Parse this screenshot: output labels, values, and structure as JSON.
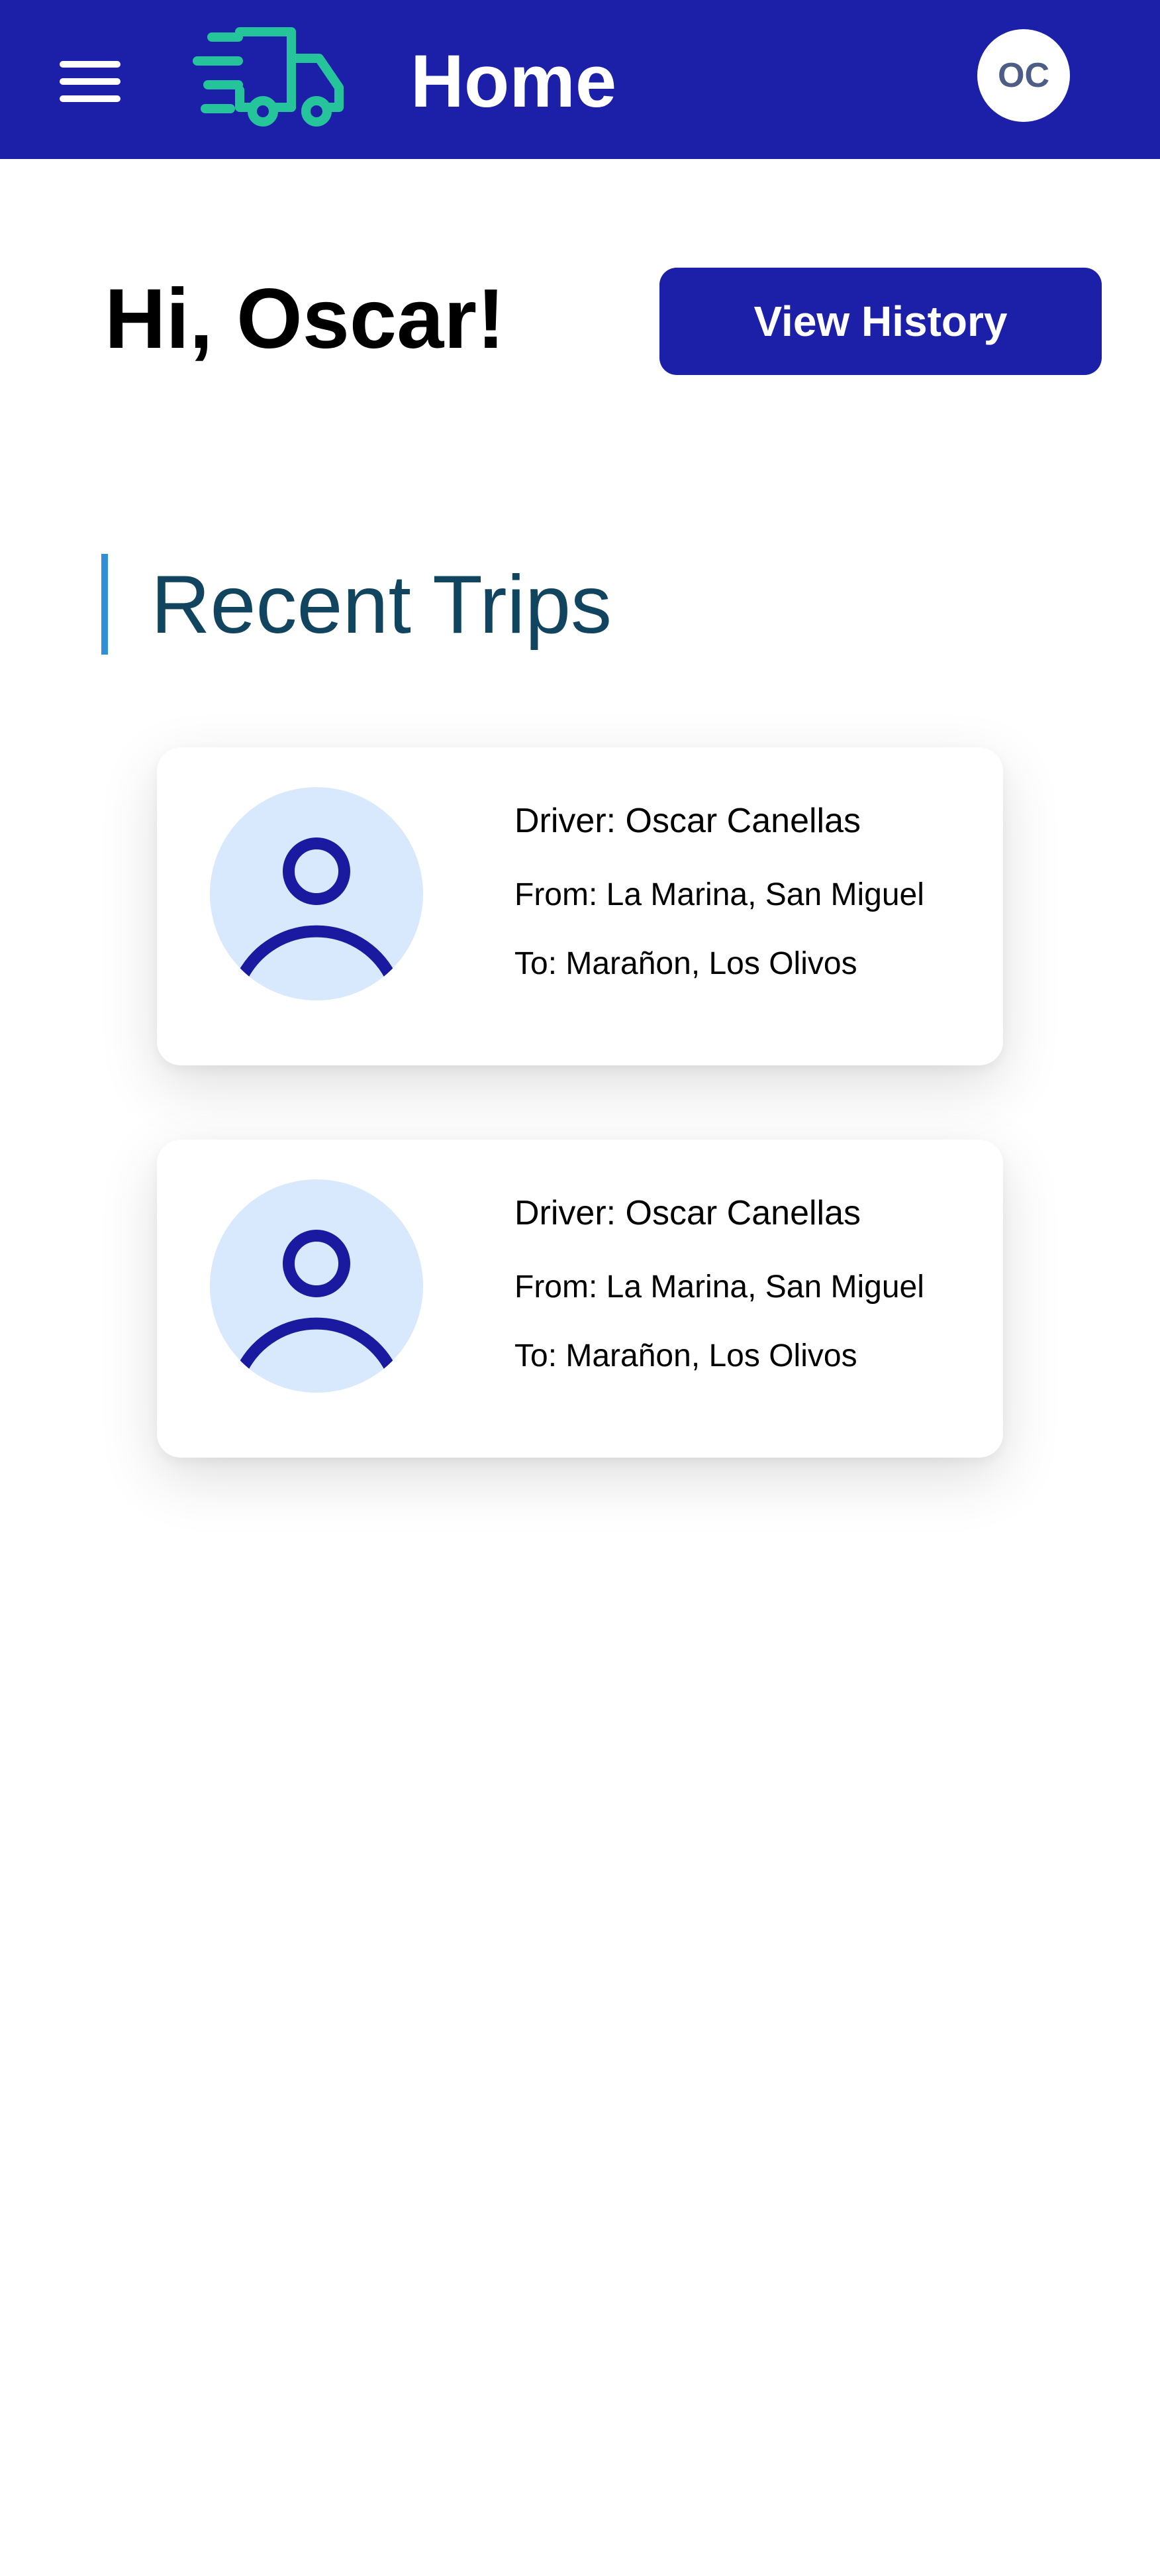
{
  "theme": {
    "header_bg": "#1c1fa8",
    "logo_color": "#25c49a",
    "accent_bar": "#2f8fd8",
    "section_title_color": "#10445f",
    "avatar_bg": "#d9e9fd",
    "avatar_icon": "#1a1aa0"
  },
  "header": {
    "menu_icon": "hamburger-icon",
    "logo_icon": "delivery-truck-icon",
    "title": "Home",
    "user_initials": "OC"
  },
  "greeting": {
    "text": "Hi, Oscar!",
    "history_button_label": "View History"
  },
  "recent_trips": {
    "title": "Recent Trips",
    "trips": [
      {
        "driver": "Driver: Oscar Canellas",
        "from": "From: La Marina, San Miguel",
        "to": "To: Marañon, Los Olivos",
        "avatar_icon": "user-icon"
      },
      {
        "driver": "Driver: Oscar Canellas",
        "from": "From: La Marina, San Miguel",
        "to": "To: Marañon, Los Olivos",
        "avatar_icon": "user-icon"
      }
    ]
  }
}
